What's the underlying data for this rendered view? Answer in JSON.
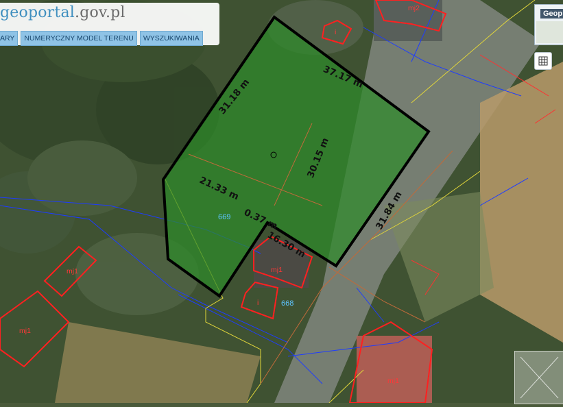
{
  "header": {
    "logo_prefix": "geo",
    "logo_main": "portal",
    "logo_domain": ".gov.pl",
    "tabs": [
      "ARY",
      "NUMERYCZNY MODEL TERENU",
      "WYSZUKIWANIA"
    ]
  },
  "minimap": {
    "title": "Geop"
  },
  "controls": {
    "grid_icon": "grid-icon",
    "nav_icon": "pan-zoom-icon"
  },
  "measurements": {
    "top_left": "31.18 m",
    "top": "37.17 m",
    "center_vertical": "30.15 m",
    "right": "31.84 m",
    "bottom_left": "21.33 m",
    "bottom_mid": "0.37 m",
    "bottom_right": "16.30 m"
  },
  "plots": [
    "669",
    "668"
  ],
  "buildings": [
    "mj1",
    "mj1",
    "mj2",
    "mj1",
    "mj1",
    "i",
    "i"
  ],
  "colors": {
    "parcel_fill": "#2e8a2a",
    "parcel_outline": "#000000",
    "building_outline": "#ff2020",
    "utility_line": "#1e3cff",
    "boundary_line": "#e2d63a"
  }
}
